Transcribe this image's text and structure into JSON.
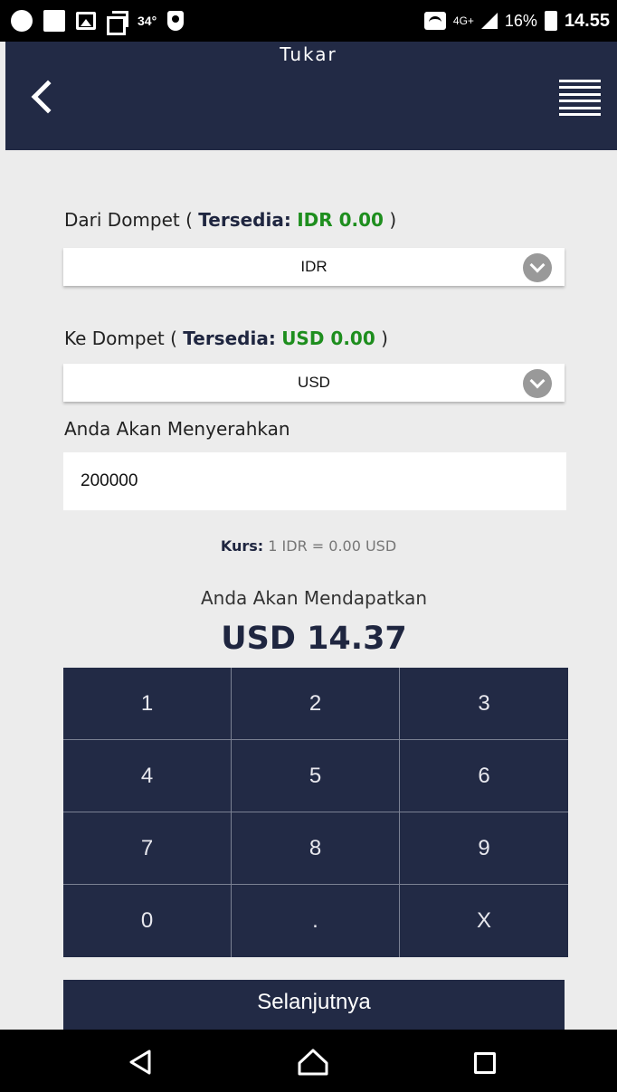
{
  "status_bar": {
    "temperature": "34°",
    "network": "4G+",
    "battery_pct": "16%",
    "time": "14.55"
  },
  "app_bar": {
    "title": "Tukar"
  },
  "from_wallet": {
    "label_prefix": "Dari Dompet ( ",
    "available_label": "Tersedia:",
    "available_value": "IDR 0.00",
    "label_suffix": " )",
    "selected": "IDR"
  },
  "to_wallet": {
    "label_prefix": "Ke Dompet ( ",
    "available_label": "Tersedia:",
    "available_value": "USD 0.00",
    "label_suffix": " )",
    "selected": "USD"
  },
  "give_amount": {
    "label": "Anda Akan Menyerahkan",
    "value": "200000"
  },
  "rate": {
    "label": "Kurs:",
    "value": " 1 IDR = 0.00 USD"
  },
  "receive": {
    "label": "Anda Akan Mendapatkan",
    "amount": "USD 14.37"
  },
  "keypad": {
    "keys": [
      "1",
      "2",
      "3",
      "4",
      "5",
      "6",
      "7",
      "8",
      "9",
      "0",
      ".",
      "X"
    ]
  },
  "next_button": {
    "label": "Selanjutnya"
  },
  "colors": {
    "primary_navy": "#222a45",
    "available_green": "#1e8e1e",
    "background": "#ececec"
  }
}
